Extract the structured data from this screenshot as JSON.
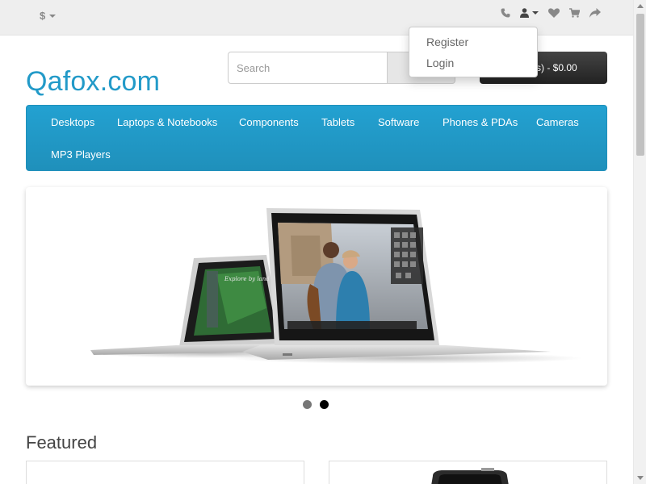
{
  "topbar": {
    "currency_symbol": "$",
    "icons": [
      "phone-icon",
      "user-icon",
      "heart-icon",
      "cart-icon",
      "share-icon"
    ]
  },
  "account_dropdown": {
    "items": [
      "Register",
      "Login"
    ]
  },
  "header": {
    "logo": "Qafox.com",
    "search_placeholder": "Search",
    "cart_label": "m(s) - $0.00"
  },
  "menu": {
    "items": [
      "Desktops",
      "Laptops & Notebooks",
      "Components",
      "Tablets",
      "Software",
      "Phones & PDAs",
      "Cameras",
      "MP3 Players"
    ]
  },
  "slideshow": {
    "active_slide": 2,
    "slide_count": 2
  },
  "featured": {
    "title": "Featured"
  },
  "colors": {
    "brand": "#229ac8",
    "menu_bg": "#229ac8",
    "topbar_bg": "#eeeeee"
  }
}
